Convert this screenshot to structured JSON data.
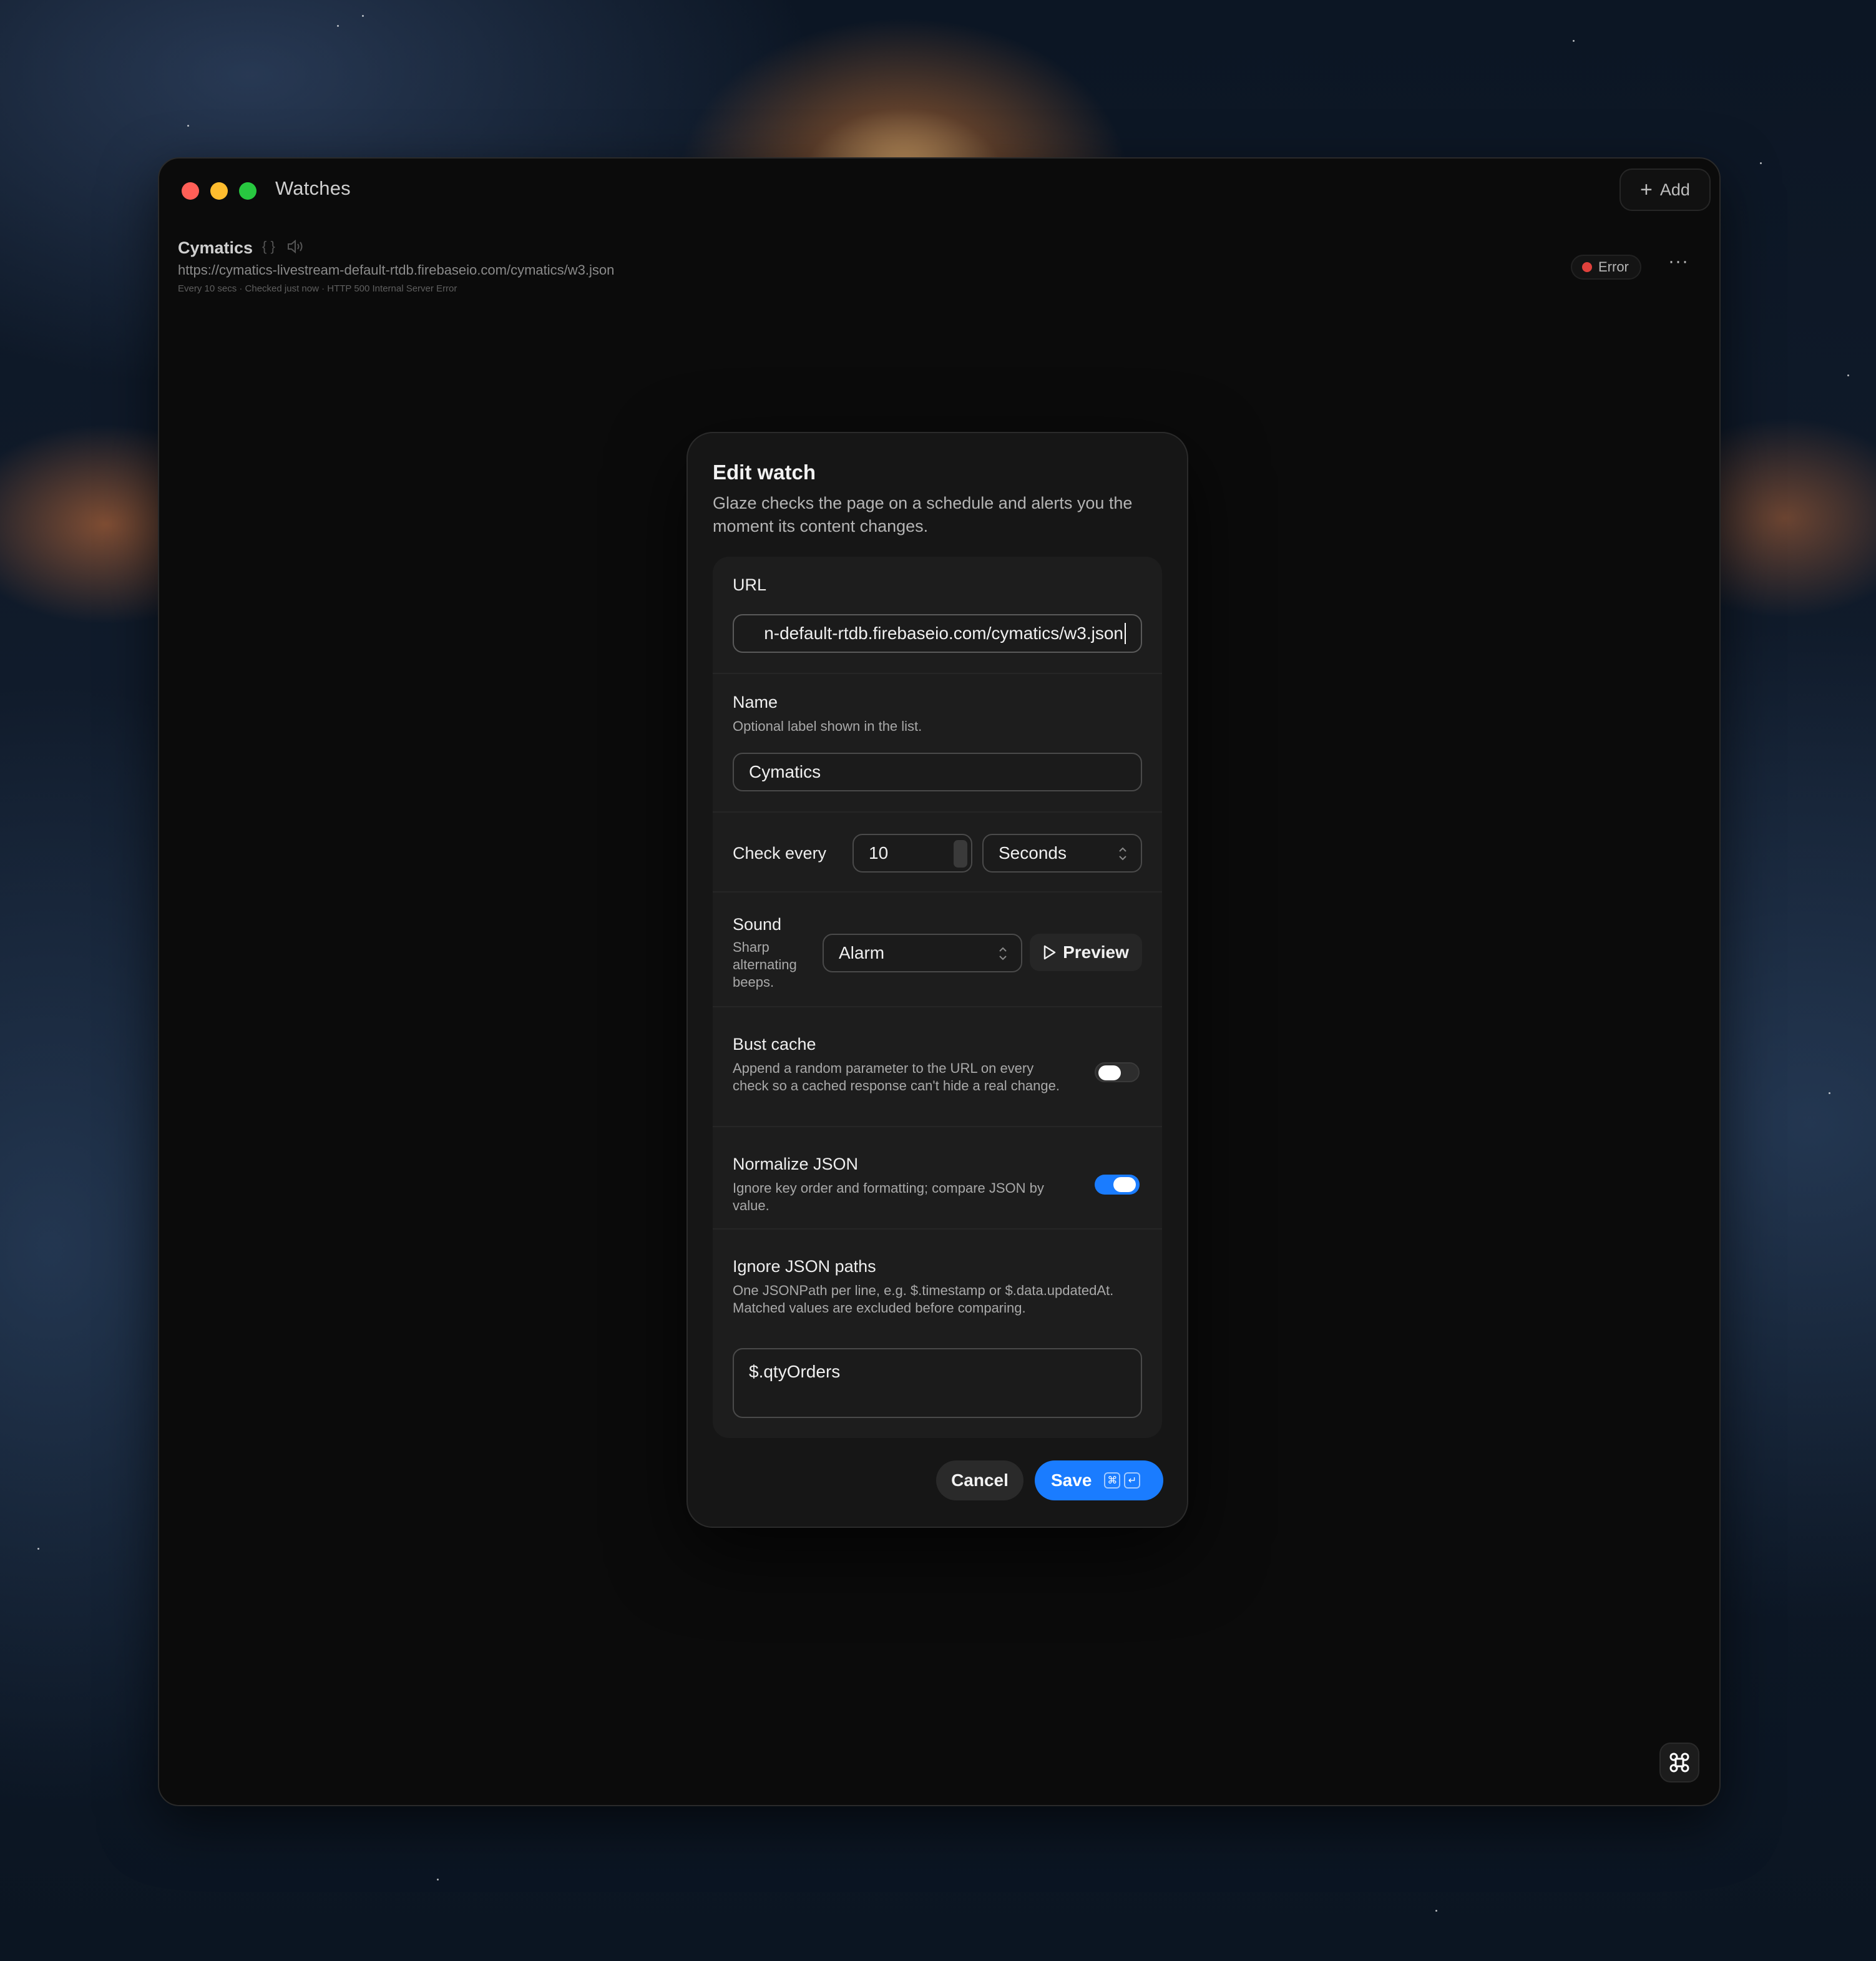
{
  "window": {
    "title": "Watches",
    "add_label": "Add"
  },
  "watch": {
    "name": "Cymatics",
    "type_glyph": "{ }",
    "url": "https://cymatics-livestream-default-rtdb.firebaseio.com/cymatics/w3.json",
    "meta": "Every 10 secs · Checked just now · HTTP 500 Internal Server Error",
    "status": "Error",
    "more_glyph": "···"
  },
  "modal": {
    "title": "Edit watch",
    "description": "Glaze checks the page on a schedule and alerts you the moment its content changes.",
    "url_label": "URL",
    "url_value": "n-default-rtdb.firebaseio.com/cymatics/w3.json",
    "name_label": "Name",
    "name_help": "Optional label shown in the list.",
    "name_value": "Cymatics",
    "check_label": "Check every",
    "check_value": "10",
    "check_unit": "Seconds",
    "sound_label": "Sound",
    "sound_help": "Sharp alternating beeps.",
    "sound_value": "Alarm",
    "preview_label": "Preview",
    "bust_label": "Bust cache",
    "bust_help": "Append a random parameter to the URL on every check so a cached response can't hide a real change.",
    "bust_enabled": false,
    "normalize_label": "Normalize JSON",
    "normalize_help": "Ignore key order and formatting; compare JSON by value.",
    "normalize_enabled": true,
    "ignore_label": "Ignore JSON paths",
    "ignore_help": "One JSONPath per line, e.g. $.timestamp or $.data.updatedAt. Matched values are excluded before comparing.",
    "ignore_value": "$.qtyOrders",
    "cancel_label": "Cancel",
    "save_label": "Save",
    "save_shortcut": [
      "⌘",
      "↵"
    ]
  },
  "colors": {
    "accent": "#1a7cff",
    "error": "#e0413c"
  }
}
